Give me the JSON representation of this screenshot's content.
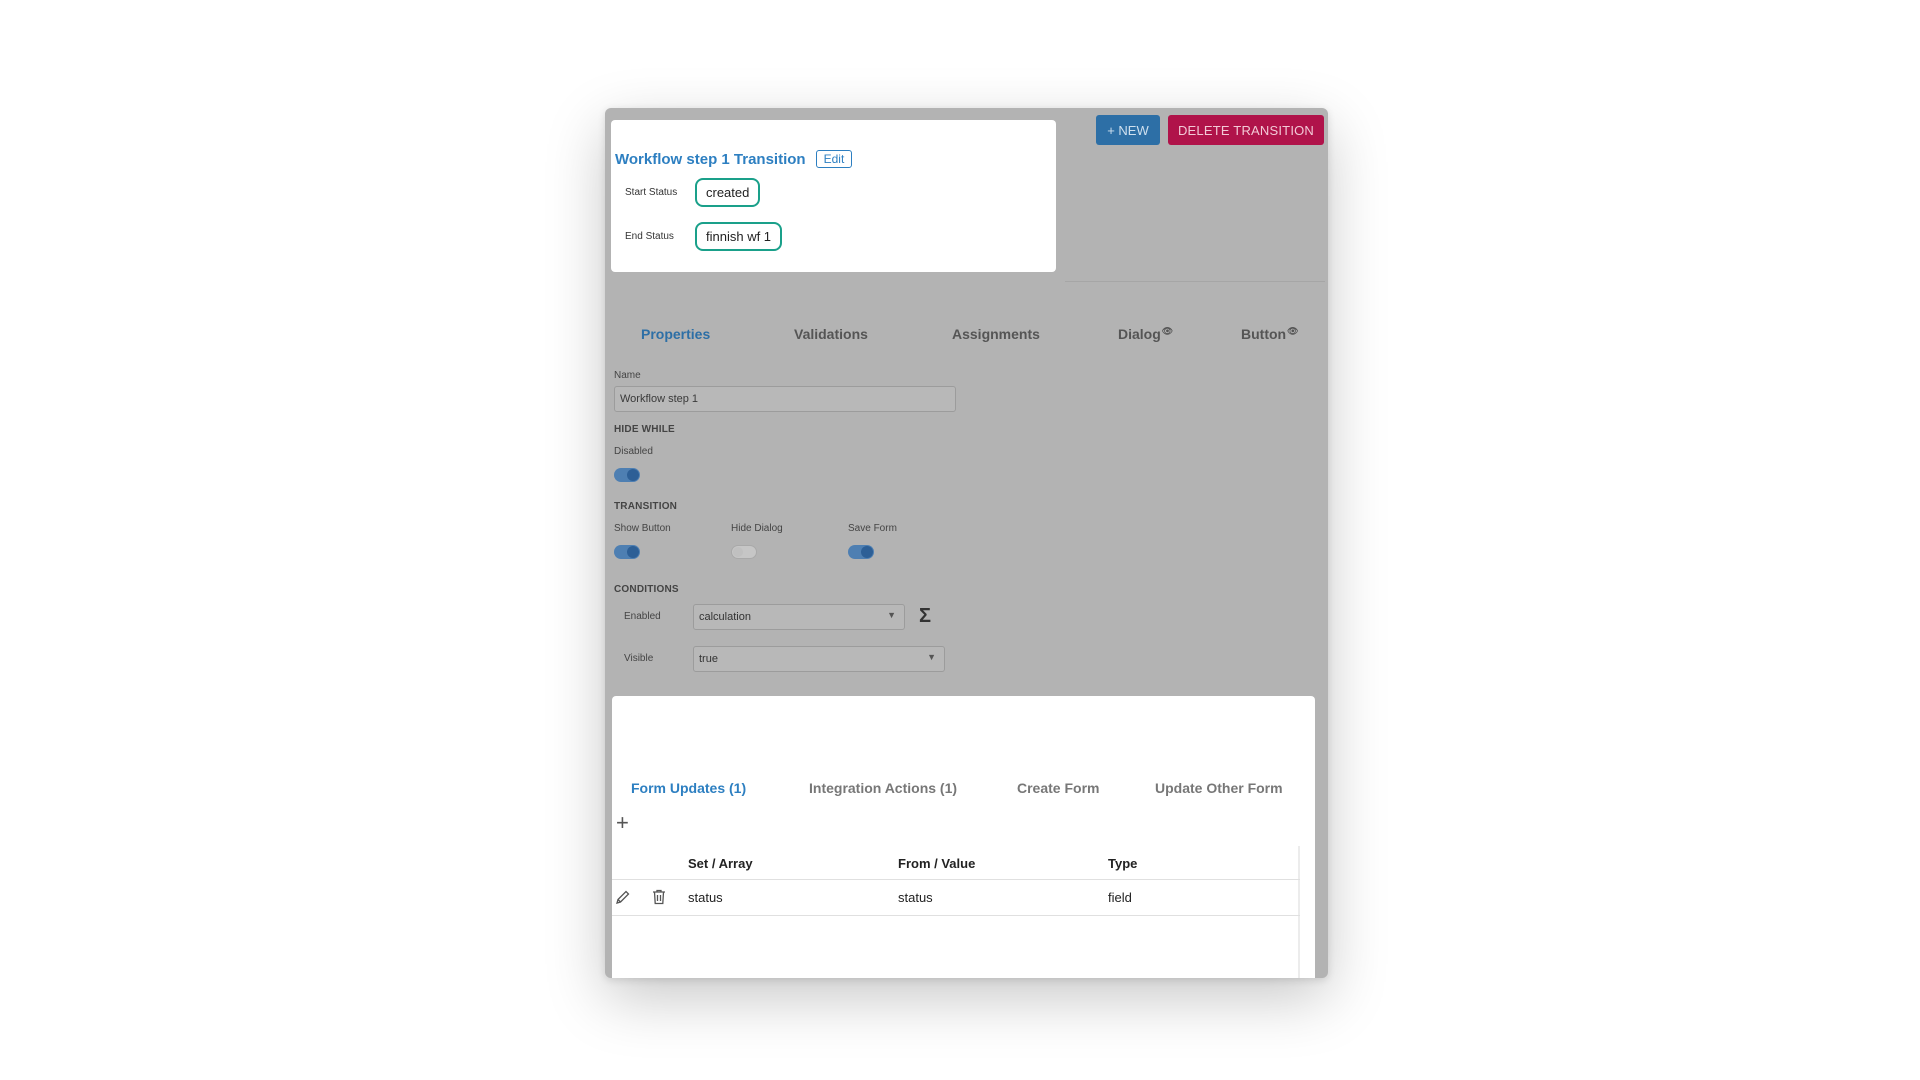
{
  "header": {
    "title": "Workflow step 1 Transition",
    "edit_label": "Edit",
    "start_status_label": "Start Status",
    "start_status_value": "created",
    "end_status_label": "End Status",
    "end_status_value": "finnish wf 1"
  },
  "actions": {
    "new_label": "+ NEW",
    "delete_label": "DELETE TRANSITION"
  },
  "tabs": [
    {
      "label": "Properties",
      "active": true
    },
    {
      "label": "Validations",
      "active": false
    },
    {
      "label": "Assignments",
      "active": false
    },
    {
      "label": "Dialog",
      "active": false,
      "icon": "eye-icon"
    },
    {
      "label": "Button",
      "active": false,
      "icon": "eye-icon"
    }
  ],
  "properties": {
    "name_label": "Name",
    "name_value": "Workflow step 1",
    "hide_while_label": "HIDE WHILE",
    "disabled_label": "Disabled",
    "disabled_on": true,
    "transition_label": "TRANSITION",
    "show_button_label": "Show Button",
    "show_button_on": true,
    "hide_dialog_label": "Hide Dialog",
    "hide_dialog_on": false,
    "save_form_label": "Save Form",
    "save_form_on": true,
    "conditions_label": "CONDITIONS",
    "enabled_label": "Enabled",
    "enabled_value": "calculation",
    "visible_label": "Visible",
    "visible_value": "true"
  },
  "bottom_tabs": [
    {
      "label": "Form Updates (1)",
      "active": true
    },
    {
      "label": "Integration Actions (1)",
      "active": false
    },
    {
      "label": "Create Form",
      "active": false
    },
    {
      "label": "Update Other Form",
      "active": false
    }
  ],
  "table": {
    "columns": [
      "Set / Array",
      "From / Value",
      "Type"
    ],
    "rows": [
      {
        "set": "status",
        "from": "status",
        "type": "field"
      }
    ]
  },
  "colors": {
    "accent": "#2d7fc1",
    "delete": "#b0134a",
    "chip_border": "#1aa08a",
    "overlay": "#b3b3b3"
  }
}
